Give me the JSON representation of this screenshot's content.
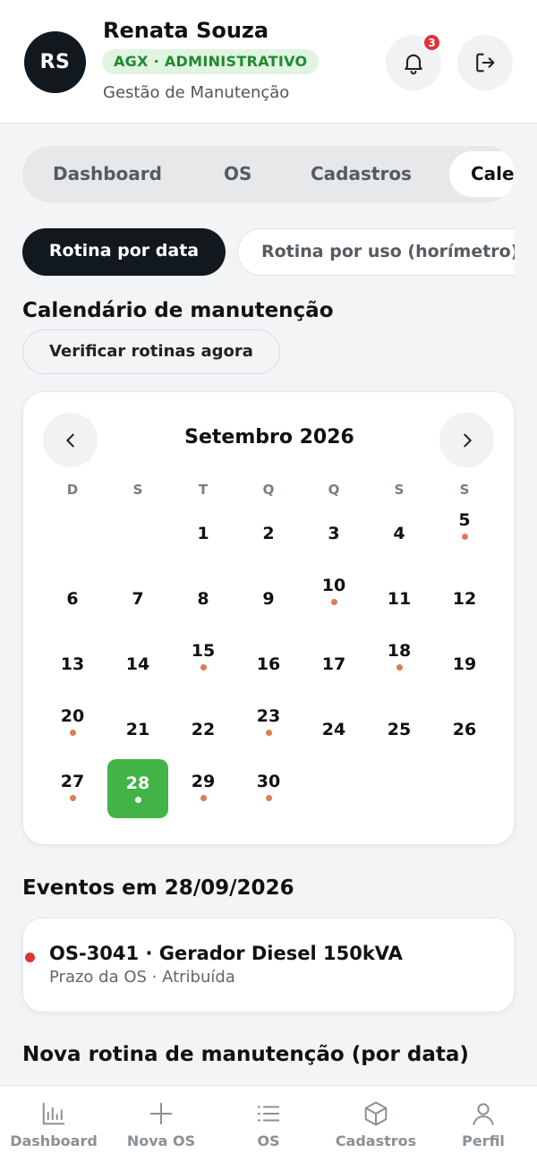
{
  "header": {
    "avatar_initials": "RS",
    "user_name": "Renata Souza",
    "role_badge": "AGX · ADMINISTRATIVO",
    "subtitle": "Gestão de Manutenção",
    "notification_count": "3"
  },
  "tabs": [
    {
      "label": "Dashboard"
    },
    {
      "label": "OS"
    },
    {
      "label": "Cadastros"
    },
    {
      "label": "Calendário",
      "active": true
    }
  ],
  "segments": {
    "active": "Rotina por data",
    "inactive": "Rotina por uso (horímetro)"
  },
  "calendar": {
    "section_title": "Calendário de manutenção",
    "verify_button": "Verificar rotinas agora",
    "month_title": "Setembro 2026",
    "weekdays": [
      "D",
      "S",
      "T",
      "Q",
      "Q",
      "S",
      "S"
    ],
    "days": [
      {
        "n": "1",
        "dot": false
      },
      {
        "n": "2",
        "dot": false
      },
      {
        "n": "3",
        "dot": false
      },
      {
        "n": "4",
        "dot": false
      },
      {
        "n": "5",
        "dot": true
      },
      {
        "n": "6",
        "dot": false
      },
      {
        "n": "7",
        "dot": false
      },
      {
        "n": "8",
        "dot": false
      },
      {
        "n": "9",
        "dot": false
      },
      {
        "n": "10",
        "dot": true
      },
      {
        "n": "11",
        "dot": false
      },
      {
        "n": "12",
        "dot": false
      },
      {
        "n": "13",
        "dot": false
      },
      {
        "n": "14",
        "dot": false
      },
      {
        "n": "15",
        "dot": true
      },
      {
        "n": "16",
        "dot": false
      },
      {
        "n": "17",
        "dot": false
      },
      {
        "n": "18",
        "dot": true
      },
      {
        "n": "19",
        "dot": false
      },
      {
        "n": "20",
        "dot": true
      },
      {
        "n": "21",
        "dot": false
      },
      {
        "n": "22",
        "dot": false
      },
      {
        "n": "23",
        "dot": true
      },
      {
        "n": "24",
        "dot": false
      },
      {
        "n": "25",
        "dot": false
      },
      {
        "n": "26",
        "dot": false
      },
      {
        "n": "27",
        "dot": true
      },
      {
        "n": "28",
        "dot": true,
        "selected": true
      },
      {
        "n": "29",
        "dot": true
      },
      {
        "n": "30",
        "dot": true
      }
    ],
    "first_weekday_index": 2
  },
  "events": {
    "title": "Eventos em 28/09/2026",
    "items": [
      {
        "title": "OS-3041 · Gerador Diesel 150kVA",
        "subtitle": "Prazo da OS · Atribuída"
      }
    ]
  },
  "new_routine_title": "Nova rotina de manutenção (por data)",
  "bottom_nav": [
    {
      "label": "Dashboard",
      "icon": "bar-chart-icon"
    },
    {
      "label": "Nova OS",
      "icon": "plus-icon"
    },
    {
      "label": "OS",
      "icon": "list-icon"
    },
    {
      "label": "Cadastros",
      "icon": "box-icon"
    },
    {
      "label": "Perfil",
      "icon": "user-icon"
    }
  ],
  "colors": {
    "dark": "#11191e",
    "accent_green": "#42b347",
    "badge_green_text": "#1f8a2f",
    "event_dot": "#e0323a",
    "day_dot": "#e07b55"
  }
}
